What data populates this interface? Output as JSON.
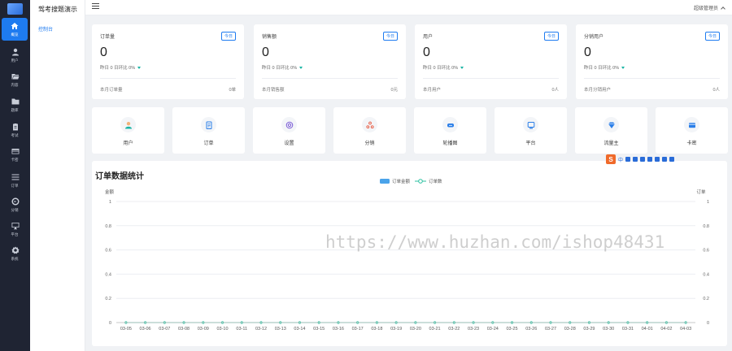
{
  "app": {
    "brand": "驾考搜题演示",
    "sub_nav_item": "控制台",
    "user": "超级管理员"
  },
  "rail": [
    {
      "label": "概览",
      "icon": "home-icon",
      "active": true
    },
    {
      "label": "用户",
      "icon": "user-icon",
      "active": false
    },
    {
      "label": "内容",
      "icon": "folder-open-icon",
      "active": false
    },
    {
      "label": "题库",
      "icon": "folder-icon",
      "active": false
    },
    {
      "label": "考试",
      "icon": "clipboard-icon",
      "active": false
    },
    {
      "label": "卡密",
      "icon": "card-icon",
      "active": false
    },
    {
      "label": "订单",
      "icon": "list-icon",
      "active": false
    },
    {
      "label": "分销",
      "icon": "share-icon",
      "active": false
    },
    {
      "label": "平台",
      "icon": "monitor-icon",
      "active": false
    },
    {
      "label": "系统",
      "icon": "gear-icon",
      "active": false
    }
  ],
  "stats": [
    {
      "title": "订单量",
      "badge": "今日",
      "value": "0",
      "compare": "昨日 0   日环比 0%",
      "month_label": "本月订单量",
      "month_value": "0单"
    },
    {
      "title": "销售额",
      "badge": "今日",
      "value": "0",
      "compare": "昨日 0   日环比 0%",
      "month_label": "本月销售额",
      "month_value": "0元"
    },
    {
      "title": "用户",
      "badge": "今日",
      "value": "0",
      "compare": "昨日 0   日环比 0%",
      "month_label": "本月用户",
      "month_value": "0人"
    },
    {
      "title": "分销用户",
      "badge": "今日",
      "value": "0",
      "compare": "昨日 0   日环比 0%",
      "month_label": "本月分销用户",
      "month_value": "0人"
    }
  ],
  "shortcuts": [
    {
      "label": "用户",
      "icon": "user-avatar-icon",
      "color": "#17b3a3"
    },
    {
      "label": "订单",
      "icon": "order-doc-icon",
      "color": "#2a7ee8"
    },
    {
      "label": "设置",
      "icon": "settings-icon",
      "color": "#7b5bd6"
    },
    {
      "label": "分销",
      "icon": "distribute-icon",
      "color": "#e8553b"
    },
    {
      "label": "轮播图",
      "icon": "carousel-icon",
      "color": "#2a7ee8"
    },
    {
      "label": "平台",
      "icon": "platform-icon",
      "color": "#2a7ee8"
    },
    {
      "label": "流量主",
      "icon": "diamond-icon",
      "color": "#2a7ee8"
    },
    {
      "label": "卡密",
      "icon": "wallet-icon",
      "color": "#2a7ee8"
    }
  ],
  "chart": {
    "title": "订单数据统计",
    "ime_char": "中",
    "watermark": "https://www.huzhan.com/ishop48431"
  },
  "chart_data": {
    "type": "bar",
    "categories": [
      "03-05",
      "03-06",
      "03-07",
      "03-08",
      "03-09",
      "03-10",
      "03-11",
      "03-12",
      "03-13",
      "03-14",
      "03-15",
      "03-16",
      "03-17",
      "03-18",
      "03-19",
      "03-20",
      "03-21",
      "03-22",
      "03-23",
      "03-24",
      "03-25",
      "03-26",
      "03-27",
      "03-28",
      "03-29",
      "03-30",
      "03-31",
      "04-01",
      "04-02",
      "04-03"
    ],
    "series": [
      {
        "name": "订单金额",
        "type": "bar",
        "axis": "left",
        "color": "#4aa3ea",
        "values": [
          0,
          0,
          0,
          0,
          0,
          0,
          0,
          0,
          0,
          0,
          0,
          0,
          0,
          0,
          0,
          0,
          0,
          0,
          0,
          0,
          0,
          0,
          0,
          0,
          0,
          0,
          0,
          0,
          0,
          0
        ]
      },
      {
        "name": "订单数",
        "type": "line",
        "axis": "right",
        "color": "#2cc1a1",
        "values": [
          0,
          0,
          0,
          0,
          0,
          0,
          0,
          0,
          0,
          0,
          0,
          0,
          0,
          0,
          0,
          0,
          0,
          0,
          0,
          0,
          0,
          0,
          0,
          0,
          0,
          0,
          0,
          0,
          0,
          0
        ]
      }
    ],
    "ylabel_left": "金额",
    "ylabel_right": "订单",
    "ylim": [
      0,
      1
    ],
    "yticks": [
      "0",
      "0.2",
      "0.4",
      "0.6",
      "0.8",
      "1"
    ],
    "legend": "top-center",
    "grid": true
  }
}
